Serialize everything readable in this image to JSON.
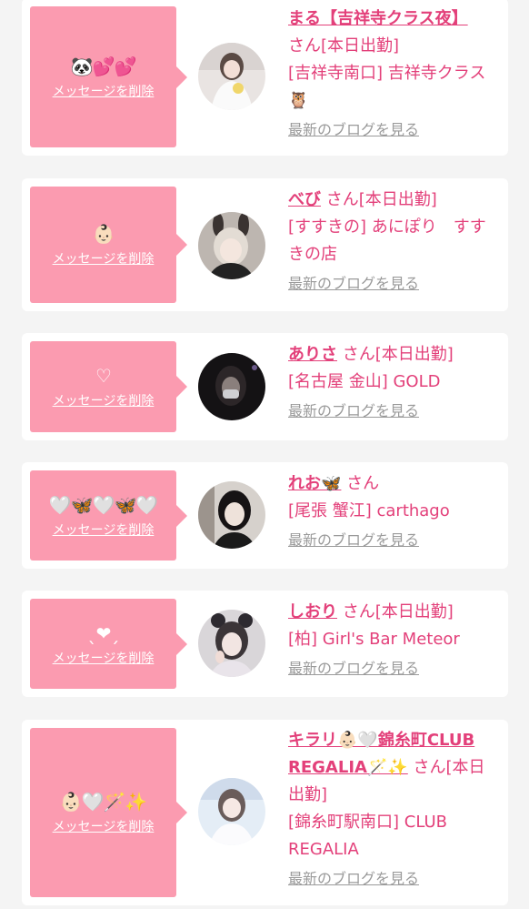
{
  "ui": {
    "delete_label": "メッセージを削除",
    "blog_label": "最新のブログを見る",
    "colors": {
      "accent": "#e3407a",
      "bubble": "#fb9bb0",
      "muted": "#9a9a9a",
      "background": "#f4f4f4"
    }
  },
  "messages": [
    {
      "emoji": "🐼💕💕",
      "name": "まる【吉祥寺クラス夜】",
      "suffix": "さん[本日出勤]",
      "shop": "[吉祥寺南口] 吉祥寺クラス🦉",
      "avatar_icon": "girl-white-dress-avatar"
    },
    {
      "emoji": "👶🏻",
      "name": "べび",
      "suffix": "さん[本日出勤]",
      "shop": "[すすきの] あにぽり　すすきの店",
      "avatar_icon": "girl-bunny-ears-avatar"
    },
    {
      "emoji": "♡",
      "name": "ありさ",
      "suffix": "さん[本日出勤]",
      "shop": "[名古屋 金山] GOLD",
      "avatar_icon": "girl-mask-dark-avatar"
    },
    {
      "emoji": "🤍🦋🤍🦋🤍",
      "name": "れお🦋",
      "suffix": "さん",
      "shop": "[尾張 蟹江] carthago",
      "avatar_icon": "girl-black-hair-avatar"
    },
    {
      "emoji": "ˎ❤︎ˏ",
      "name": "しおり",
      "suffix": "さん[本日出勤]",
      "shop": "[柏] Girl's Bar Meteor",
      "avatar_icon": "girl-selfie-avatar"
    },
    {
      "emoji": "👶🏻🤍🪄✨",
      "name": "キラリ👶🏻🤍錦糸町CLUB REGALIA🪄✨",
      "suffix": "さん[本日出勤]",
      "shop": "[錦糸町駅南口] CLUB REGALIA",
      "avatar_icon": "girl-white-outfit-avatar"
    }
  ]
}
